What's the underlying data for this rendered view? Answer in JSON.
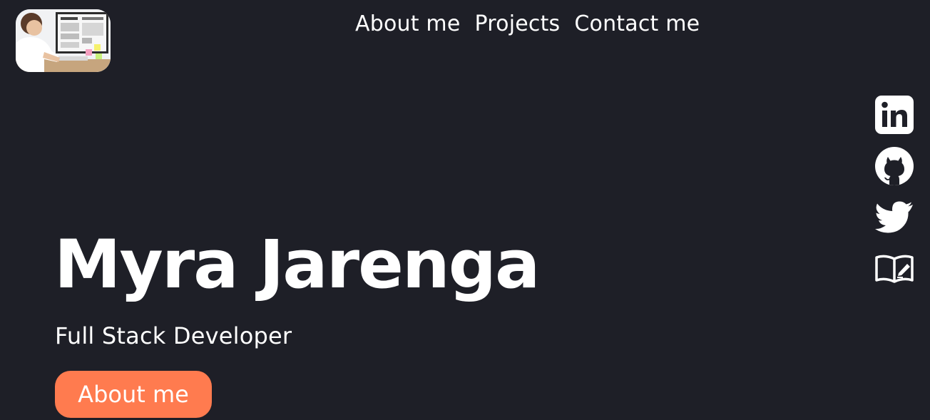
{
  "nav": {
    "items": [
      {
        "label": "About me"
      },
      {
        "label": "Projects"
      },
      {
        "label": "Contact me"
      }
    ]
  },
  "hero": {
    "name": "Myra Jarenga",
    "role": "Full Stack Developer",
    "cta_label": "About me"
  },
  "social": {
    "icons": [
      "linkedin-icon",
      "github-icon",
      "twitter-icon",
      "blog-icon"
    ]
  },
  "colors": {
    "background": "#1e1f27",
    "text": "#ffffff",
    "accent": "#ff7b4f"
  }
}
